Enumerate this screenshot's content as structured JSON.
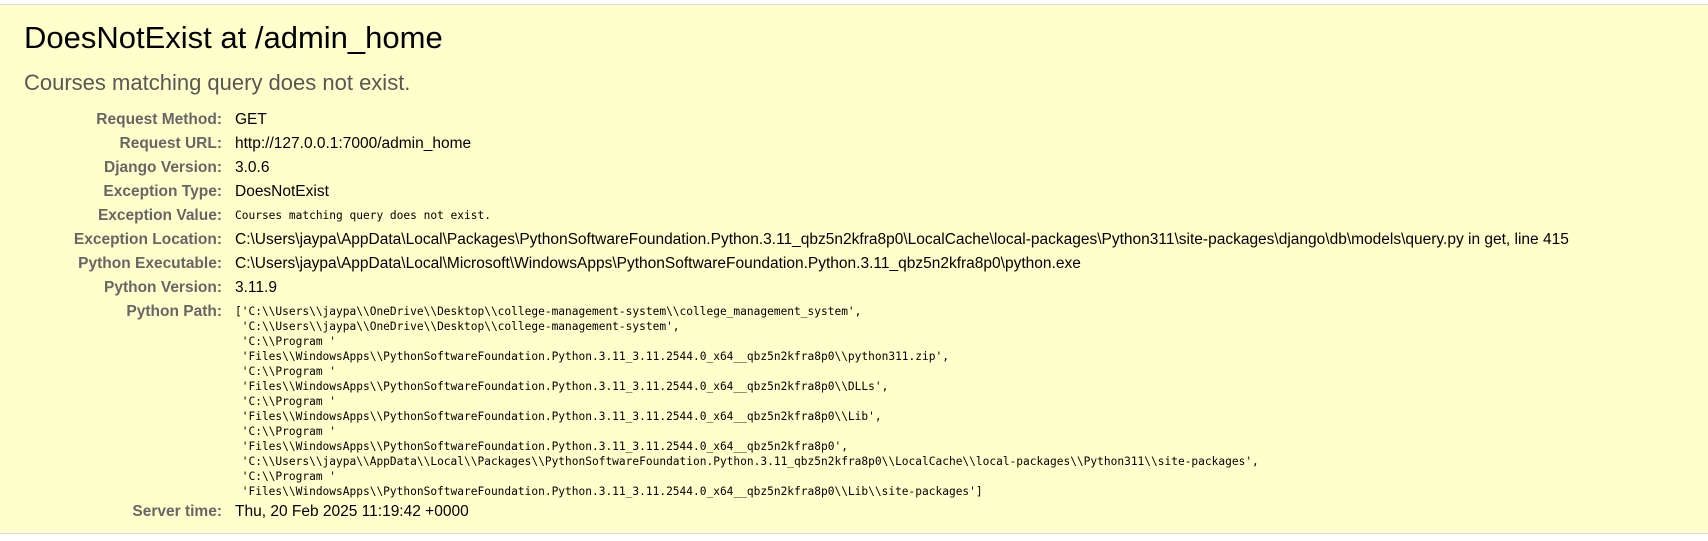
{
  "error": {
    "title": "DoesNotExist at /admin_home",
    "message": "Courses matching query does not exist."
  },
  "meta": {
    "request_method": {
      "label": "Request Method:",
      "value": "GET"
    },
    "request_url": {
      "label": "Request URL:",
      "value": "http://127.0.0.1:7000/admin_home"
    },
    "django_version": {
      "label": "Django Version:",
      "value": "3.0.6"
    },
    "exception_type": {
      "label": "Exception Type:",
      "value": "DoesNotExist"
    },
    "exception_value": {
      "label": "Exception Value:",
      "value": "Courses matching query does not exist."
    },
    "exception_location": {
      "label": "Exception Location:",
      "value": "C:\\Users\\jaypa\\AppData\\Local\\Packages\\PythonSoftwareFoundation.Python.3.11_qbz5n2kfra8p0\\LocalCache\\local-packages\\Python311\\site-packages\\django\\db\\models\\query.py in get, line 415"
    },
    "python_executable": {
      "label": "Python Executable:",
      "value": "C:\\Users\\jaypa\\AppData\\Local\\Microsoft\\WindowsApps\\PythonSoftwareFoundation.Python.3.11_qbz5n2kfra8p0\\python.exe"
    },
    "python_version": {
      "label": "Python Version:",
      "value": "3.11.9"
    },
    "python_path": {
      "label": "Python Path:",
      "lines": [
        "['C:\\\\Users\\\\jaypa\\\\OneDrive\\\\Desktop\\\\college-management-system\\\\college_management_system',",
        " 'C:\\\\Users\\\\jaypa\\\\OneDrive\\\\Desktop\\\\college-management-system',",
        " 'C:\\\\Program '",
        " 'Files\\\\WindowsApps\\\\PythonSoftwareFoundation.Python.3.11_3.11.2544.0_x64__qbz5n2kfra8p0\\\\python311.zip',",
        " 'C:\\\\Program '",
        " 'Files\\\\WindowsApps\\\\PythonSoftwareFoundation.Python.3.11_3.11.2544.0_x64__qbz5n2kfra8p0\\\\DLLs',",
        " 'C:\\\\Program '",
        " 'Files\\\\WindowsApps\\\\PythonSoftwareFoundation.Python.3.11_3.11.2544.0_x64__qbz5n2kfra8p0\\\\Lib',",
        " 'C:\\\\Program '",
        " 'Files\\\\WindowsApps\\\\PythonSoftwareFoundation.Python.3.11_3.11.2544.0_x64__qbz5n2kfra8p0',",
        " 'C:\\\\Users\\\\jaypa\\\\AppData\\\\Local\\\\Packages\\\\PythonSoftwareFoundation.Python.3.11_qbz5n2kfra8p0\\\\LocalCache\\\\local-packages\\\\Python311\\\\site-packages',",
        " 'C:\\\\Program '",
        " 'Files\\\\WindowsApps\\\\PythonSoftwareFoundation.Python.3.11_3.11.2544.0_x64__qbz5n2kfra8p0\\\\Lib\\\\site-packages']"
      ]
    },
    "server_time": {
      "label": "Server time:",
      "value": "Thu, 20 Feb 2025 11:19:42 +0000"
    }
  },
  "colors": {
    "summary_background": "#ffffcc",
    "label_text": "#666666",
    "subtitle_text": "#575757"
  }
}
